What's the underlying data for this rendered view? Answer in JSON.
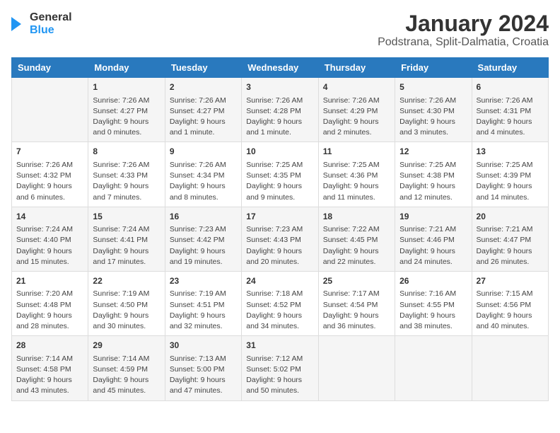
{
  "logo": {
    "text_general": "General",
    "text_blue": "Blue"
  },
  "title": "January 2024",
  "subtitle": "Podstrana, Split-Dalmatia, Croatia",
  "days_of_week": [
    "Sunday",
    "Monday",
    "Tuesday",
    "Wednesday",
    "Thursday",
    "Friday",
    "Saturday"
  ],
  "weeks": [
    [
      {
        "day": "",
        "info": ""
      },
      {
        "day": "1",
        "info": "Sunrise: 7:26 AM\nSunset: 4:27 PM\nDaylight: 9 hours\nand 0 minutes."
      },
      {
        "day": "2",
        "info": "Sunrise: 7:26 AM\nSunset: 4:27 PM\nDaylight: 9 hours\nand 1 minute."
      },
      {
        "day": "3",
        "info": "Sunrise: 7:26 AM\nSunset: 4:28 PM\nDaylight: 9 hours\nand 1 minute."
      },
      {
        "day": "4",
        "info": "Sunrise: 7:26 AM\nSunset: 4:29 PM\nDaylight: 9 hours\nand 2 minutes."
      },
      {
        "day": "5",
        "info": "Sunrise: 7:26 AM\nSunset: 4:30 PM\nDaylight: 9 hours\nand 3 minutes."
      },
      {
        "day": "6",
        "info": "Sunrise: 7:26 AM\nSunset: 4:31 PM\nDaylight: 9 hours\nand 4 minutes."
      }
    ],
    [
      {
        "day": "7",
        "info": "Sunrise: 7:26 AM\nSunset: 4:32 PM\nDaylight: 9 hours\nand 6 minutes."
      },
      {
        "day": "8",
        "info": "Sunrise: 7:26 AM\nSunset: 4:33 PM\nDaylight: 9 hours\nand 7 minutes."
      },
      {
        "day": "9",
        "info": "Sunrise: 7:26 AM\nSunset: 4:34 PM\nDaylight: 9 hours\nand 8 minutes."
      },
      {
        "day": "10",
        "info": "Sunrise: 7:25 AM\nSunset: 4:35 PM\nDaylight: 9 hours\nand 9 minutes."
      },
      {
        "day": "11",
        "info": "Sunrise: 7:25 AM\nSunset: 4:36 PM\nDaylight: 9 hours\nand 11 minutes."
      },
      {
        "day": "12",
        "info": "Sunrise: 7:25 AM\nSunset: 4:38 PM\nDaylight: 9 hours\nand 12 minutes."
      },
      {
        "day": "13",
        "info": "Sunrise: 7:25 AM\nSunset: 4:39 PM\nDaylight: 9 hours\nand 14 minutes."
      }
    ],
    [
      {
        "day": "14",
        "info": "Sunrise: 7:24 AM\nSunset: 4:40 PM\nDaylight: 9 hours\nand 15 minutes."
      },
      {
        "day": "15",
        "info": "Sunrise: 7:24 AM\nSunset: 4:41 PM\nDaylight: 9 hours\nand 17 minutes."
      },
      {
        "day": "16",
        "info": "Sunrise: 7:23 AM\nSunset: 4:42 PM\nDaylight: 9 hours\nand 19 minutes."
      },
      {
        "day": "17",
        "info": "Sunrise: 7:23 AM\nSunset: 4:43 PM\nDaylight: 9 hours\nand 20 minutes."
      },
      {
        "day": "18",
        "info": "Sunrise: 7:22 AM\nSunset: 4:45 PM\nDaylight: 9 hours\nand 22 minutes."
      },
      {
        "day": "19",
        "info": "Sunrise: 7:21 AM\nSunset: 4:46 PM\nDaylight: 9 hours\nand 24 minutes."
      },
      {
        "day": "20",
        "info": "Sunrise: 7:21 AM\nSunset: 4:47 PM\nDaylight: 9 hours\nand 26 minutes."
      }
    ],
    [
      {
        "day": "21",
        "info": "Sunrise: 7:20 AM\nSunset: 4:48 PM\nDaylight: 9 hours\nand 28 minutes."
      },
      {
        "day": "22",
        "info": "Sunrise: 7:19 AM\nSunset: 4:50 PM\nDaylight: 9 hours\nand 30 minutes."
      },
      {
        "day": "23",
        "info": "Sunrise: 7:19 AM\nSunset: 4:51 PM\nDaylight: 9 hours\nand 32 minutes."
      },
      {
        "day": "24",
        "info": "Sunrise: 7:18 AM\nSunset: 4:52 PM\nDaylight: 9 hours\nand 34 minutes."
      },
      {
        "day": "25",
        "info": "Sunrise: 7:17 AM\nSunset: 4:54 PM\nDaylight: 9 hours\nand 36 minutes."
      },
      {
        "day": "26",
        "info": "Sunrise: 7:16 AM\nSunset: 4:55 PM\nDaylight: 9 hours\nand 38 minutes."
      },
      {
        "day": "27",
        "info": "Sunrise: 7:15 AM\nSunset: 4:56 PM\nDaylight: 9 hours\nand 40 minutes."
      }
    ],
    [
      {
        "day": "28",
        "info": "Sunrise: 7:14 AM\nSunset: 4:58 PM\nDaylight: 9 hours\nand 43 minutes."
      },
      {
        "day": "29",
        "info": "Sunrise: 7:14 AM\nSunset: 4:59 PM\nDaylight: 9 hours\nand 45 minutes."
      },
      {
        "day": "30",
        "info": "Sunrise: 7:13 AM\nSunset: 5:00 PM\nDaylight: 9 hours\nand 47 minutes."
      },
      {
        "day": "31",
        "info": "Sunrise: 7:12 AM\nSunset: 5:02 PM\nDaylight: 9 hours\nand 50 minutes."
      },
      {
        "day": "",
        "info": ""
      },
      {
        "day": "",
        "info": ""
      },
      {
        "day": "",
        "info": ""
      }
    ]
  ]
}
